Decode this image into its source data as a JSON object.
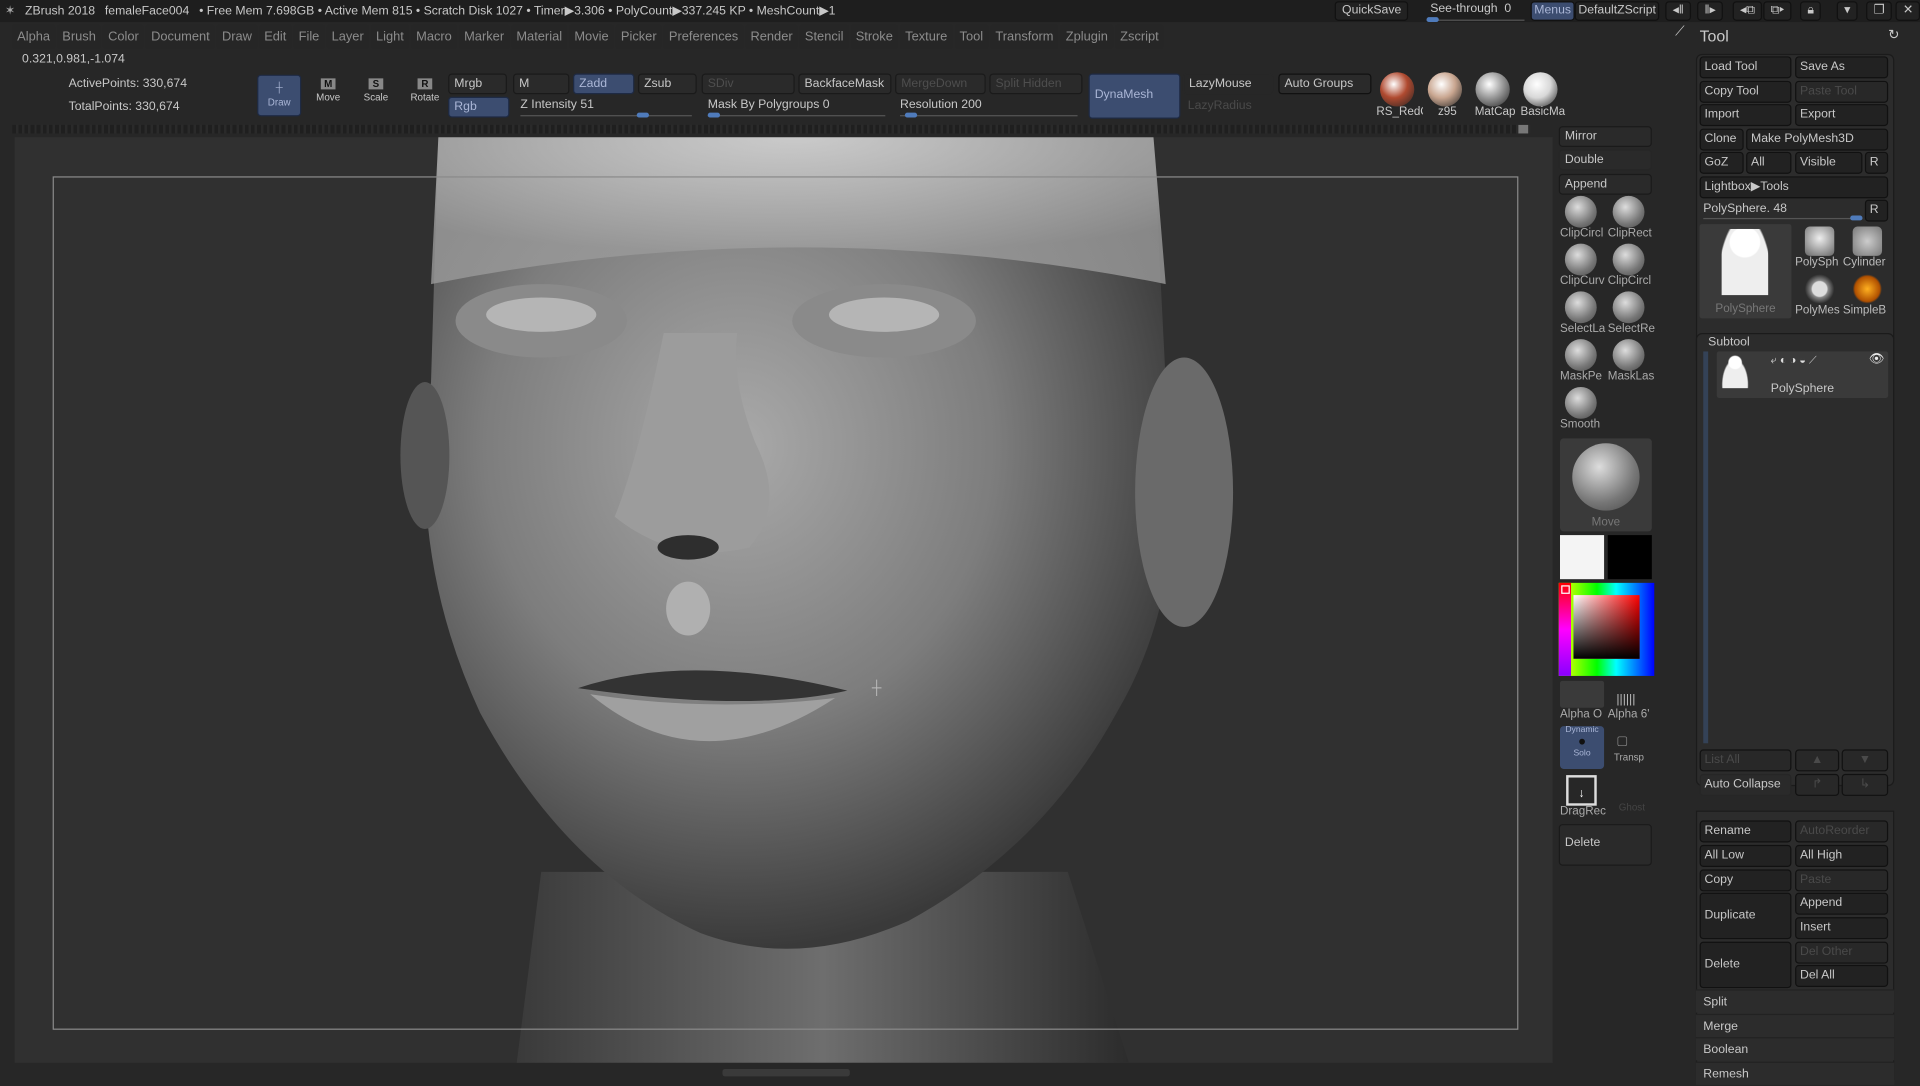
{
  "titlebar": {
    "app": "ZBrush 2018",
    "document": "femaleFace004",
    "stats": "• Free Mem 7.698GB • Active Mem 815 • Scratch Disk 1027 •  Timer▶3.306 • PolyCount▶337.245 KP • MeshCount▶1",
    "quicksave": "QuickSave",
    "see_through_label": "See-through",
    "see_through_value": "0",
    "see_through_fraction": 0,
    "menus": "Menus",
    "script": "DefaultZScript"
  },
  "menus": [
    "Alpha",
    "Brush",
    "Color",
    "Document",
    "Draw",
    "Edit",
    "File",
    "Layer",
    "Light",
    "Macro",
    "Marker",
    "Material",
    "Movie",
    "Picker",
    "Preferences",
    "Render",
    "Stencil",
    "Stroke",
    "Texture",
    "Tool",
    "Transform",
    "Zplugin",
    "Zscript"
  ],
  "coords": "0.321,0.981,-1.074",
  "info": {
    "active_points": "ActivePoints: 330,674",
    "total_points": "TotalPoints: 330,674"
  },
  "toolbar": {
    "draw": "Draw",
    "move": "Move",
    "scale": "Scale",
    "rotate": "Rotate",
    "move_key": "M",
    "scale_key": "S",
    "rotate_key": "R",
    "mrgb": "Mrgb",
    "rgb": "Rgb",
    "m": "M",
    "zadd": "Zadd",
    "zsub": "Zsub",
    "sdiv": "SDiv",
    "z_intensity_label": "Z Intensity",
    "z_intensity": "51",
    "backface": "BackfaceMask",
    "mergedown": "MergeDown",
    "split_hidden": "Split Hidden",
    "mask_polygroups_label": "Mask By Polygroups",
    "mask_polygroups": "0",
    "resolution_label": "Resolution",
    "resolution": "200",
    "dynamesh": "DynaMesh",
    "lazymouse": "LazyMouse",
    "lazyradius": "LazyRadius",
    "auto_groups": "Auto Groups",
    "materials": [
      {
        "name": "RS_RedC",
        "color": "#b04a30"
      },
      {
        "name": "z95",
        "color": "#c9a690"
      },
      {
        "name": "MatCap",
        "color": "#9a9a9a"
      },
      {
        "name": "BasicMa",
        "color": "#d8d8d8"
      }
    ]
  },
  "shelf": {
    "mirror": "Mirror",
    "double": "Double",
    "append": "Append",
    "brushes": [
      "ClipCircl",
      "ClipRect",
      "ClipCurv",
      "ClipCircl",
      "SelectLa",
      "SelectRe",
      "MaskPe",
      "MaskLas",
      "Smooth"
    ],
    "current_brush": "Move",
    "alpha_off": "Alpha O",
    "alpha_6": "Alpha 6'",
    "dynamic": "Dynamic",
    "solo": "Solo",
    "transp": "Transp",
    "dragrect": "DragRec",
    "ghost": "Ghost",
    "delete": "Delete"
  },
  "tool": {
    "title": "Tool",
    "load": "Load Tool",
    "save_as": "Save As",
    "copy": "Copy Tool",
    "paste": "Paste Tool",
    "import": "Import",
    "export": "Export",
    "clone": "Clone",
    "make_polymesh": "Make PolyMesh3D",
    "goz": "GoZ",
    "all": "All",
    "visible": "Visible",
    "r": "R",
    "lightbox": "Lightbox▶Tools",
    "polysphere_label": "PolySphere. 48",
    "main_thumb": "PolySphere",
    "thumbs": [
      "PolySph",
      "Cylinder",
      "PolyMes",
      "SimpleB"
    ]
  },
  "subtool": {
    "title": "Subtool",
    "item": "PolySphere",
    "list_all": "List All",
    "auto_collapse": "Auto Collapse",
    "rename": "Rename",
    "autoreorder": "AutoReorder",
    "all_low": "All Low",
    "all_high": "All High",
    "copy": "Copy",
    "paste": "Paste",
    "duplicate": "Duplicate",
    "append": "Append",
    "insert": "Insert",
    "delete": "Delete",
    "del_other": "Del Other",
    "del_all": "Del All",
    "sections": [
      "Split",
      "Merge",
      "Boolean",
      "Remesh"
    ]
  }
}
